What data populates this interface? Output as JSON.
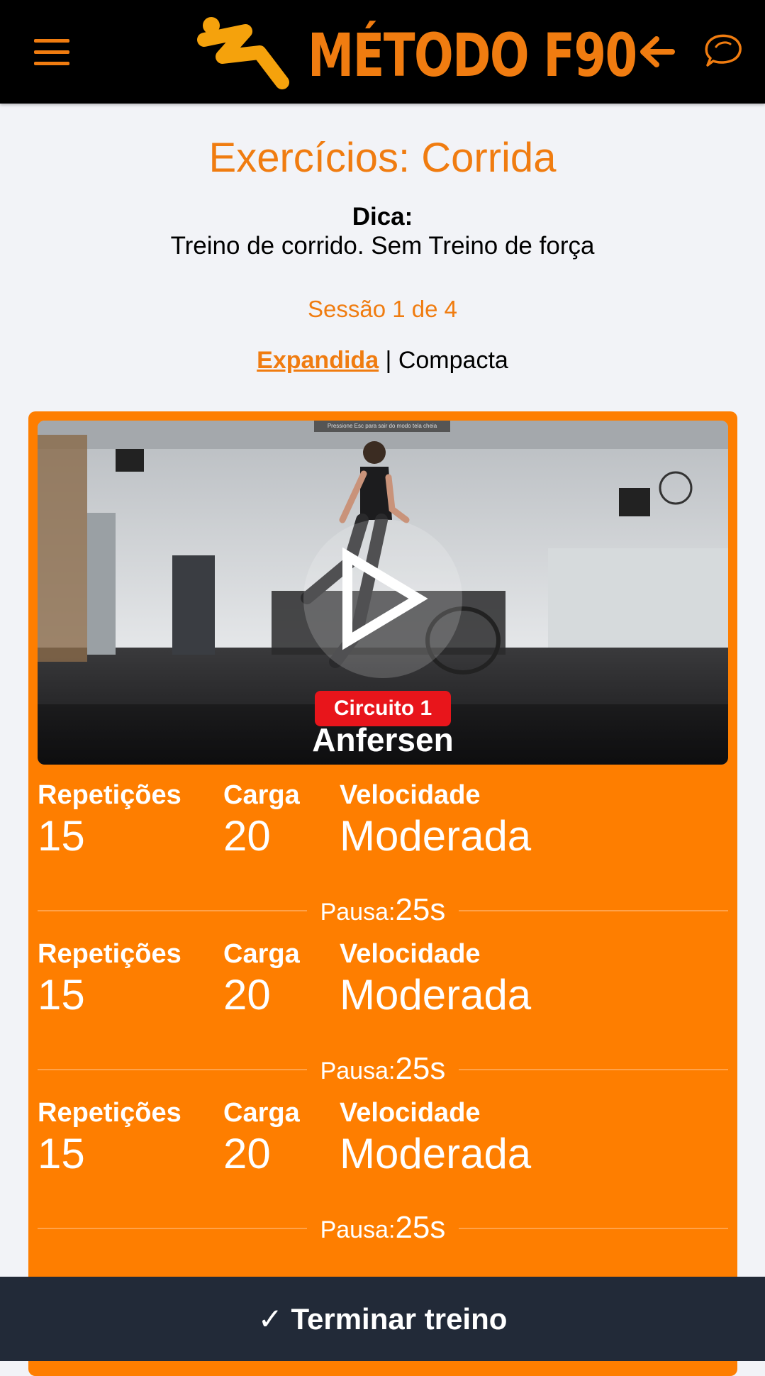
{
  "header": {
    "logo_text": "MÉTODO F90",
    "menu_icon": "hamburger-menu-icon",
    "back_icon": "arrow-left-icon",
    "chat_icon": "chat-bubble-icon"
  },
  "main": {
    "title": "Exercícios: Corrida",
    "tip_label": "Dica:",
    "tip_text": "Treino de corrido. Sem Treino de força",
    "session": "Sessão 1 de 4",
    "view_expanded": "Expandida",
    "view_separator": " | ",
    "view_compact": "Compacta"
  },
  "exercise": {
    "video_hint": "Pressione Esc para sair do modo tela cheia",
    "circuit": "Circuito 1",
    "name": "Anfersen",
    "sets": [
      {
        "reps_label": "Repetições",
        "reps": "15",
        "load_label": "Carga",
        "load": "20",
        "speed_label": "Velocidade",
        "speed": "Moderada",
        "pause_label": "Pausa:",
        "pause": "25s"
      },
      {
        "reps_label": "Repetições",
        "reps": "15",
        "load_label": "Carga",
        "load": "20",
        "speed_label": "Velocidade",
        "speed": "Moderada",
        "pause_label": "Pausa:",
        "pause": "25s"
      },
      {
        "reps_label": "Repetições",
        "reps": "15",
        "load_label": "Carga",
        "load": "20",
        "speed_label": "Velocidade",
        "speed": "Moderada",
        "pause_label": "Pausa:",
        "pause": "25s"
      }
    ]
  },
  "footer": {
    "finish_label": "✓ Terminar treino"
  },
  "colors": {
    "accent": "#f07c10",
    "card": "#fe7e00",
    "badge": "#e8151b",
    "footer": "#222a38"
  }
}
